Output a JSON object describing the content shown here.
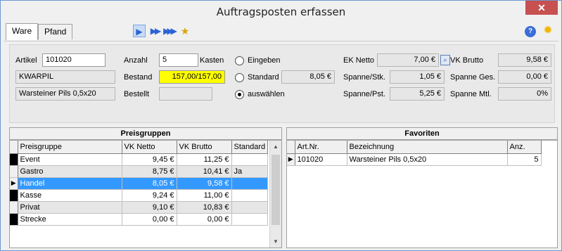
{
  "window": {
    "title": "Auftragsposten erfassen",
    "close_glyph": "✕"
  },
  "tabs": [
    {
      "label": "Ware"
    },
    {
      "label": "Pfand"
    }
  ],
  "toolbar": {
    "icons": [
      "play-icon",
      "fast-forward-icon",
      "skip-forward-icon",
      "favorite-star-icon",
      "help-icon",
      "settings-sun-icon"
    ]
  },
  "form": {
    "artikel_label": "Artikel",
    "artikel_value": "101020",
    "short_name": "KWARPIL",
    "description": "Warsteiner Pils 0,5x20",
    "anzahl_label": "Anzahl",
    "anzahl_value": "5",
    "kasten_label": "Kasten",
    "bestand_label": "Bestand",
    "bestand_value": "157,00/157,00",
    "bestellt_label": "Bestellt",
    "bestellt_value": "",
    "radio_eingeben": "Eingeben",
    "radio_standard": "Standard",
    "radio_standard_value": "8,05 €",
    "radio_auswaehlen": "auswählen",
    "selected_radio": "auswählen",
    "ek_netto_label": "EK Netto",
    "ek_netto_value": "7,00 €",
    "spanne_stk_label": "Spanne/Stk.",
    "spanne_stk_value": "1,05 €",
    "spanne_pst_label": "Spanne/Pst.",
    "spanne_pst_value": "5,25 €",
    "vk_brutto_label": "VK Brutto",
    "vk_brutto_value": "9,58 €",
    "spanne_ges_label": "Spanne Ges.",
    "spanne_ges_value": "0,00 €",
    "spanne_mtl_label": "Spanne Mtl.",
    "spanne_mtl_value": "0%"
  },
  "preisgruppen": {
    "title": "Preisgruppen",
    "columns": [
      "Preisgruppe",
      "VK Netto",
      "VK Brutto",
      "Standard"
    ],
    "rows": [
      {
        "name": "Event",
        "vk_netto": "9,45 €",
        "vk_brutto": "11,25 €",
        "standard": ""
      },
      {
        "name": "Gastro",
        "vk_netto": "8,75 €",
        "vk_brutto": "10,41 €",
        "standard": "Ja"
      },
      {
        "name": "Handel",
        "vk_netto": "8,05 €",
        "vk_brutto": "9,58 €",
        "standard": ""
      },
      {
        "name": "Kasse",
        "vk_netto": "9,24 €",
        "vk_brutto": "11,00 €",
        "standard": ""
      },
      {
        "name": "Privat",
        "vk_netto": "9,10 €",
        "vk_brutto": "10,83 €",
        "standard": ""
      },
      {
        "name": "Strecke",
        "vk_netto": "0,00 €",
        "vk_brutto": "0,00 €",
        "standard": ""
      }
    ],
    "selected_row": "Handel"
  },
  "favoriten": {
    "title": "Favoriten",
    "columns": [
      "Art.Nr.",
      "Bezeichnung",
      "Anz."
    ],
    "rows": [
      {
        "art_nr": "101020",
        "bezeichnung": "Warsteiner Pils 0,5x20",
        "anz": "5"
      }
    ]
  }
}
